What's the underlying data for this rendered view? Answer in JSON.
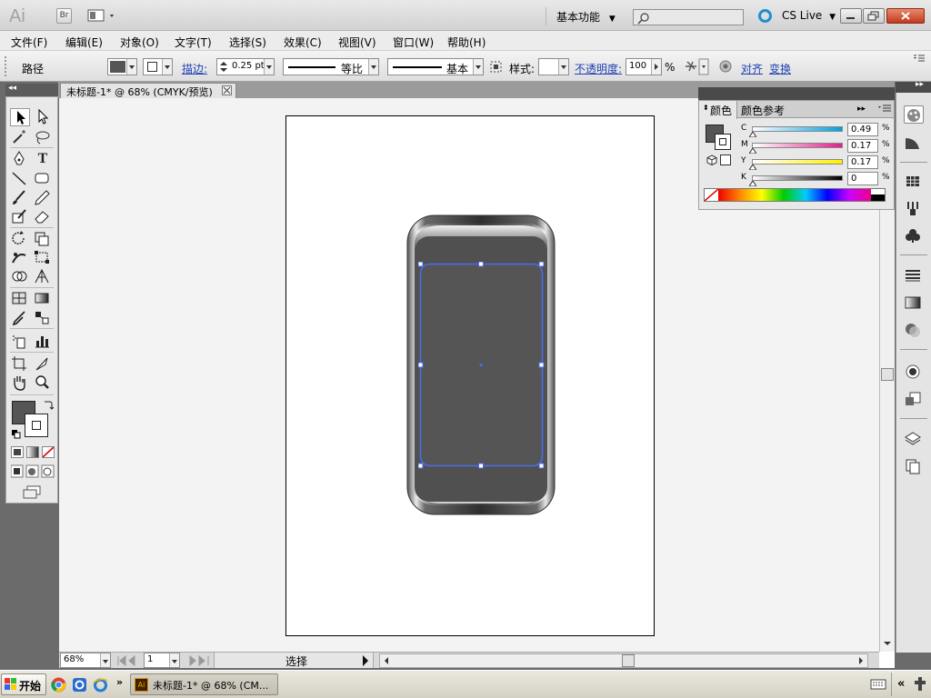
{
  "app": {
    "logo": "Ai",
    "bridge_label": "Br",
    "workspace": "基本功能",
    "cs_live": "CS Live"
  },
  "menu": [
    "文件(F)",
    "编辑(E)",
    "对象(O)",
    "文字(T)",
    "选择(S)",
    "效果(C)",
    "视图(V)",
    "窗口(W)",
    "帮助(H)"
  ],
  "control": {
    "object_type": "路径",
    "stroke_label": "描边:",
    "stroke_weight": "0.25 pt",
    "stroke_profile": "等比",
    "brush": "基本",
    "style_label": "样式:",
    "opacity_label": "不透明度:",
    "opacity_value": "100",
    "opacity_unit": "%",
    "align_link": "对齐",
    "transform_link": "变换"
  },
  "document": {
    "tab_title": "未标题-1* @ 68% (CMYK/预览)"
  },
  "color_panel": {
    "tab_color": "颜色",
    "tab_guide": "颜色参考",
    "sliders": [
      {
        "name": "C",
        "value": "0.49",
        "unit": "%"
      },
      {
        "name": "M",
        "value": "0.17",
        "unit": "%"
      },
      {
        "name": "Y",
        "value": "0.17",
        "unit": "%"
      },
      {
        "name": "K",
        "value": "0",
        "unit": "%"
      }
    ]
  },
  "status": {
    "zoom": "68%",
    "page": "1",
    "tool_name": "选择"
  },
  "taskbar": {
    "start": "开始",
    "task_item": "未标题-1* @ 68% (CM..."
  },
  "colors": {
    "fill": "#555555",
    "selection": "#4a6cf0",
    "desktop": "#6b6b6b"
  }
}
